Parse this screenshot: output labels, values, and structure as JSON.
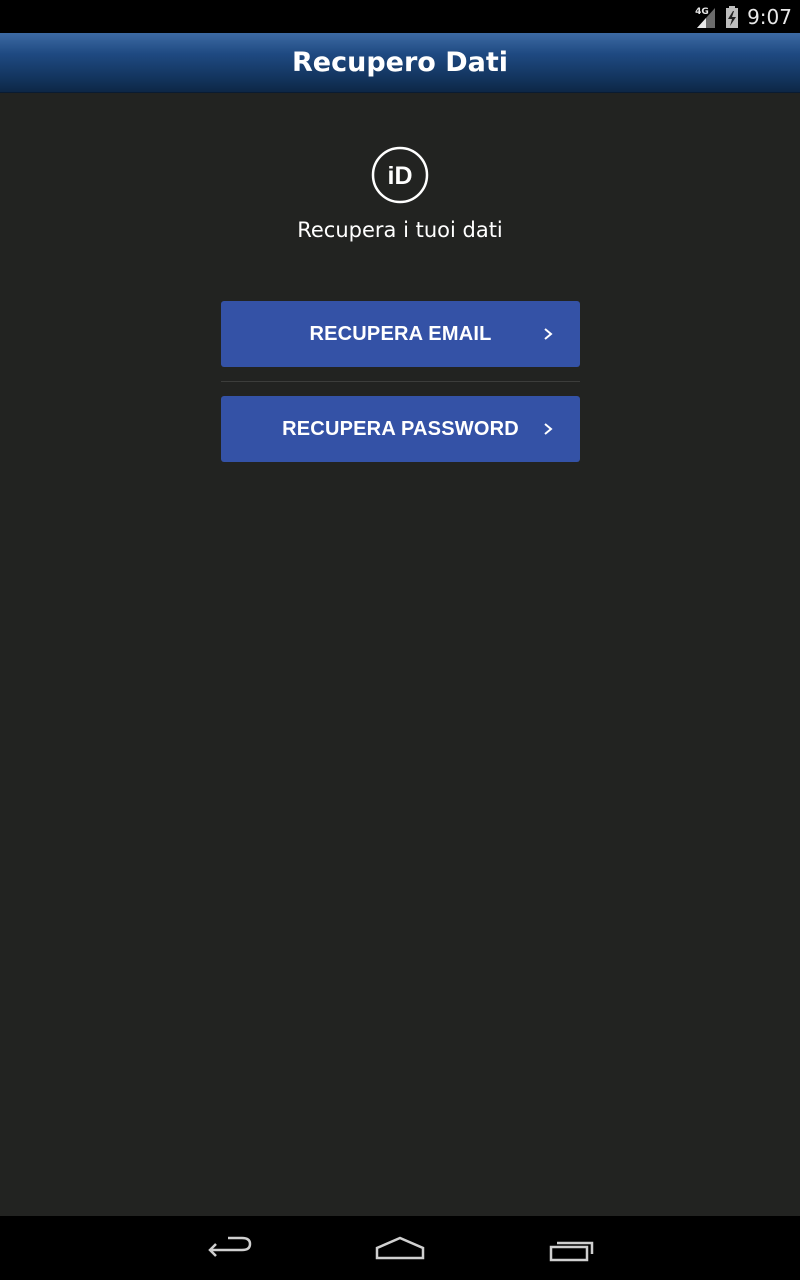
{
  "status_bar": {
    "network_type": "4G",
    "time": "9:07",
    "icons": [
      "signal-icon",
      "battery-charging-icon"
    ]
  },
  "app_bar": {
    "title": "Recupero Dati"
  },
  "content": {
    "icon": "id-icon",
    "icon_text": "iD",
    "subtitle": "Recupera i tuoi dati",
    "buttons": [
      {
        "label": "RECUPERA EMAIL",
        "icon": "chevron-right-icon"
      },
      {
        "label": "RECUPERA PASSWORD",
        "icon": "chevron-right-icon"
      }
    ]
  },
  "nav_bar": {
    "icons": [
      "back-icon",
      "home-icon",
      "recent-apps-icon"
    ]
  },
  "colors": {
    "background": "#222321",
    "app_bar": "#1f4a82",
    "button": "#3452a6",
    "text": "#ffffff"
  }
}
